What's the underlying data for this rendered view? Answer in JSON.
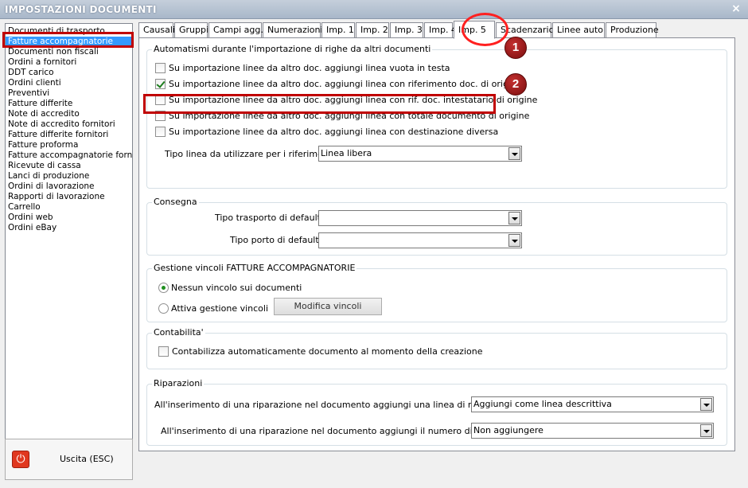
{
  "window": {
    "title": "IMPOSTAZIONI DOCUMENTI",
    "close_glyph": "×"
  },
  "sidebar": {
    "items": [
      "Documenti di trasporto",
      "Fatture accompagnatorie",
      "Documenti non fiscali",
      "Ordini a fornitori",
      "DDT carico",
      "Ordini clienti",
      "Preventivi",
      "Fatture differite",
      "Note di accredito",
      "Note di accredito fornitori",
      "Fatture differite fornitori",
      "Fatture proforma",
      "Fatture accompagnatorie fornito",
      "Ricevute di cassa",
      "Lanci di produzione",
      "Ordini di lavorazione",
      "Rapporti di lavorazione",
      "Carrello",
      "Ordini web",
      "Ordini eBay"
    ],
    "selected_index": 1,
    "exit_label": "Uscita (ESC)",
    "exit_icon": "power-icon"
  },
  "tabs": [
    "Causali",
    "Gruppi",
    "Campi agg.",
    "Numerazioni",
    "Imp. 1",
    "Imp. 2",
    "Imp. 3",
    "Imp. 4",
    "Imp. 5",
    "Scadenzario",
    "Linee auto",
    "Produzione"
  ],
  "active_tab": "Imp. 5",
  "annotations": {
    "badge1": "1",
    "badge2": "2",
    "highlight_color": "#c00000"
  },
  "automatismi": {
    "legend": "Automatismi durante l'importazione di righe da altri documenti",
    "options": [
      {
        "label": "Su importazione linee da altro doc. aggiungi linea vuota in testa",
        "checked": false
      },
      {
        "label": "Su importazione linee da altro doc. aggiungi linea con riferimento doc. di origine",
        "checked": true
      },
      {
        "label": "Su importazione linee da altro doc. aggiungi linea con rif. doc. intestatario di origine",
        "checked": false
      },
      {
        "label": "Su importazione linee da altro doc. aggiungi linea con totale documento di origine",
        "checked": false
      },
      {
        "label": "Su importazione linee da altro doc. aggiungi linea con destinazione diversa",
        "checked": false
      }
    ],
    "tipo_linea_label": "Tipo linea da utilizzare per i riferimenti :",
    "tipo_linea_value": "Linea libera"
  },
  "consegna": {
    "legend": "Consegna",
    "trasporto_label": "Tipo trasporto di default :",
    "trasporto_value": "",
    "porto_label": "Tipo porto di default :",
    "porto_value": ""
  },
  "vincoli": {
    "legend": "Gestione vincoli FATTURE ACCOMPAGNATORIE",
    "option_none": "Nessun vincolo sui documenti",
    "option_attiva": "Attiva gestione vincoli",
    "selected": "none",
    "modifica_label": "Modifica vincoli"
  },
  "contabilita": {
    "legend": "Contabilita'",
    "option": "Contabilizza automaticamente documento al momento della creazione",
    "checked": false
  },
  "riparazioni": {
    "legend": "Riparazioni",
    "rif_label": "All'inserimento di una riparazione nel documento aggiungi una linea di riferimento :",
    "rif_value": "Aggiungi come linea descrittiva",
    "matricola_label": "All'inserimento di una riparazione nel documento aggiungi il numero di matricola :",
    "matricola_value": "Non aggiungere"
  }
}
